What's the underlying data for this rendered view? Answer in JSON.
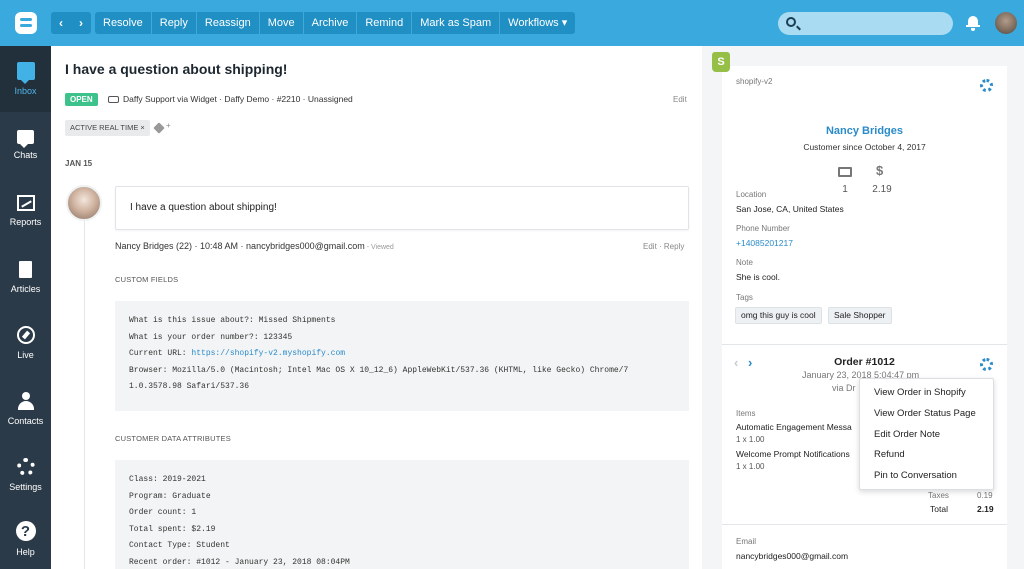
{
  "toolbar": {
    "nav_prev": "‹",
    "nav_next": "›",
    "actions": [
      "Resolve",
      "Reply",
      "Reassign",
      "Move",
      "Archive",
      "Remind",
      "Mark as Spam",
      "Workflows ▾"
    ],
    "search_placeholder": ""
  },
  "sidebar": {
    "items": [
      {
        "label": "Inbox",
        "icon": "inbox-icon",
        "active": true
      },
      {
        "label": "Chats",
        "icon": "chats-icon"
      },
      {
        "label": "Reports",
        "icon": "reports-icon"
      },
      {
        "label": "Articles",
        "icon": "articles-icon"
      },
      {
        "label": "Live",
        "icon": "compass-icon"
      },
      {
        "label": "Contacts",
        "icon": "contacts-icon"
      },
      {
        "label": "Settings",
        "icon": "gear-icon"
      },
      {
        "label": "Help",
        "icon": "help-icon"
      }
    ]
  },
  "conversation": {
    "subject": "I have a question about shipping!",
    "status": "OPEN",
    "meta": "Daffy Support via Widget · Daffy Demo · #2210 · Unassigned",
    "edit_label": "Edit",
    "tag": "ACTIVE REAL TIME  ×",
    "date_header": "JAN 15",
    "message": {
      "text": "I have a question about shipping!",
      "author_line": "Nancy Bridges (22) · 10:48 AM · nancybridges000@gmail.com",
      "viewed": " - Viewed",
      "actions": "Edit  ·  Reply"
    },
    "custom_fields_title": "CUSTOM FIELDS",
    "custom_fields": {
      "line1": "What is this issue about?: Missed Shipments",
      "line2": "What is your order number?: 123345",
      "line3_label": "Current URL: ",
      "line3_link": "https://shopify-v2.myshopify.com",
      "line4": "Browser: Mozilla/5.0 (Macintosh; Intel Mac OS X 10_12_6) AppleWebKit/537.36 (KHTML, like Gecko) Chrome/7",
      "line5": "1.0.3578.98 Safari/537.36"
    },
    "customer_data_title": "CUSTOMER DATA ATTRIBUTES",
    "customer_data": [
      "Class: 2019-2021",
      "Program: Graduate",
      "Order count: 1",
      "Total spent: $2.19",
      "Contact Type: Student",
      "Recent order: #1012 - January 23, 2018 08:04PM"
    ]
  },
  "customer": {
    "store": "shopify-v2",
    "name": "Nancy Bridges",
    "since": "Customer since October 4, 2017",
    "orders_count": "1",
    "total_spent": "2.19",
    "dollar_symbol": "$",
    "location_label": "Location",
    "location": "San Jose, CA, United States",
    "phone_label": "Phone Number",
    "phone": "+14085201217",
    "note_label": "Note",
    "note": "She is cool.",
    "tags_label": "Tags",
    "tags": [
      "omg this guy is cool",
      "Sale Shopper"
    ]
  },
  "order": {
    "title": "Order #1012",
    "date": "January 23, 2018 5:04:47 pm",
    "via": "via Dr",
    "items_label": "Items",
    "items": [
      {
        "name": "Automatic Engagement Messa",
        "qty": "1 x 1.00"
      },
      {
        "name": "Welcome Prompt Notifications",
        "qty": "1 x 1.00"
      }
    ],
    "taxes_label": "Taxes",
    "taxes": "0.19",
    "total_label": "Total",
    "total": "2.19",
    "email_label": "Email",
    "email": "nancybridges000@gmail.com"
  },
  "order_menu": [
    "View Order in Shopify",
    "View Order Status Page",
    "Edit Order Note",
    "Refund",
    "Pin to Conversation"
  ]
}
